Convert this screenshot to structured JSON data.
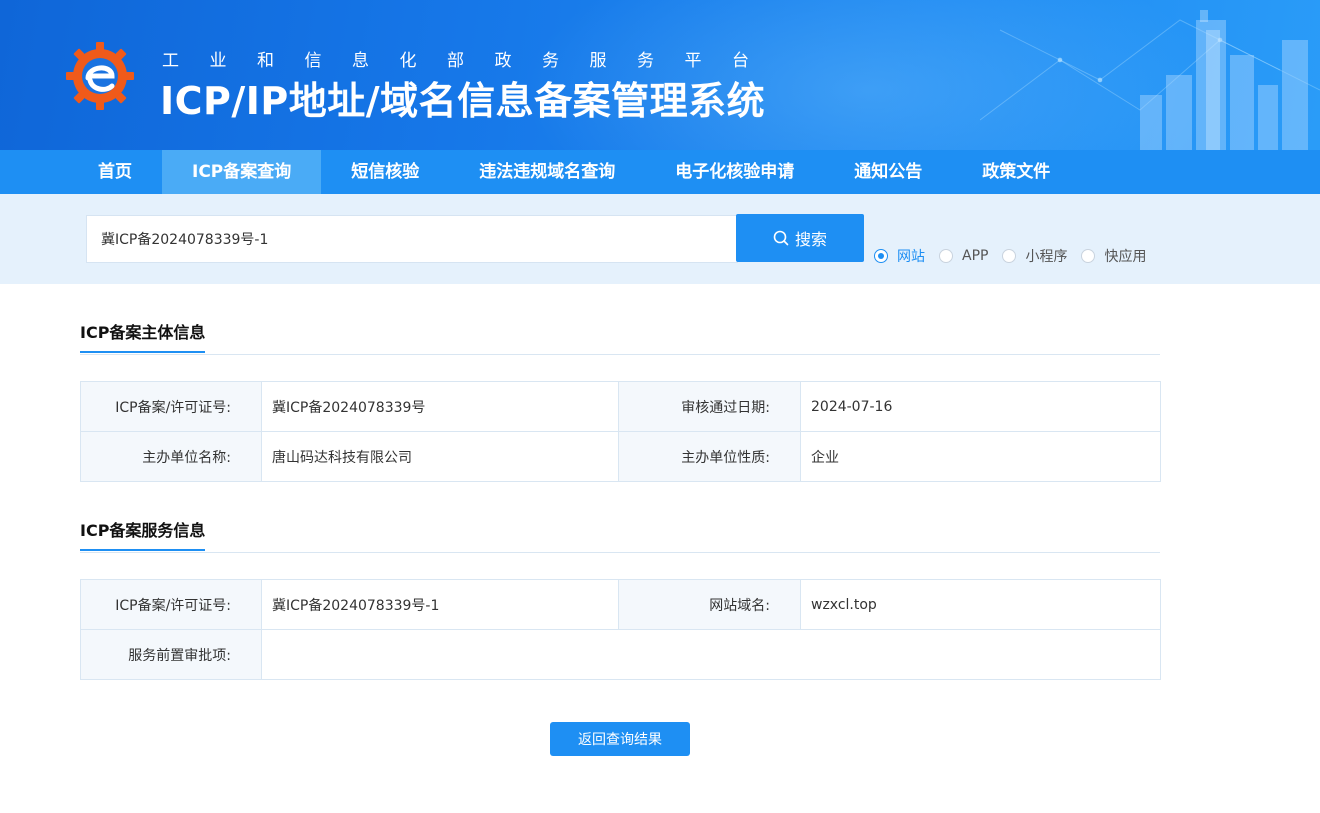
{
  "header": {
    "subtitle": "工业和信息化部政务服务平台",
    "title": "ICP/IP地址/域名信息备案管理系统"
  },
  "nav": {
    "items": [
      {
        "label": "首页",
        "active": false
      },
      {
        "label": "ICP备案查询",
        "active": true
      },
      {
        "label": "短信核验",
        "active": false
      },
      {
        "label": "违法违规域名查询",
        "active": false
      },
      {
        "label": "电子化核验申请",
        "active": false
      },
      {
        "label": "通知公告",
        "active": false
      },
      {
        "label": "政策文件",
        "active": false
      }
    ]
  },
  "search": {
    "value": "冀ICP备2024078339号-1",
    "button_label": "搜索",
    "types": [
      {
        "label": "网站",
        "checked": true
      },
      {
        "label": "APP",
        "checked": false
      },
      {
        "label": "小程序",
        "checked": false
      },
      {
        "label": "快应用",
        "checked": false
      }
    ]
  },
  "subject_info": {
    "section_title": "ICP备案主体信息",
    "license_label": "ICP备案/许可证号:",
    "license_value": "冀ICP备2024078339号",
    "approval_date_label": "审核通过日期:",
    "approval_date_value": "2024-07-16",
    "org_name_label": "主办单位名称:",
    "org_name_value": "唐山码达科技有限公司",
    "org_type_label": "主办单位性质:",
    "org_type_value": "企业"
  },
  "service_info": {
    "section_title": "ICP备案服务信息",
    "license_label": "ICP备案/许可证号:",
    "license_value": "冀ICP备2024078339号-1",
    "domain_label": "网站域名:",
    "domain_value": "wzxcl.top",
    "pre_approval_label": "服务前置审批项:",
    "pre_approval_value": ""
  },
  "back_button_label": "返回查询结果",
  "colors": {
    "primary": "#1e8ff3",
    "nav_active": "#4aabf6",
    "search_band": "#e5f1fc",
    "logo_orange": "#f05a1a"
  }
}
